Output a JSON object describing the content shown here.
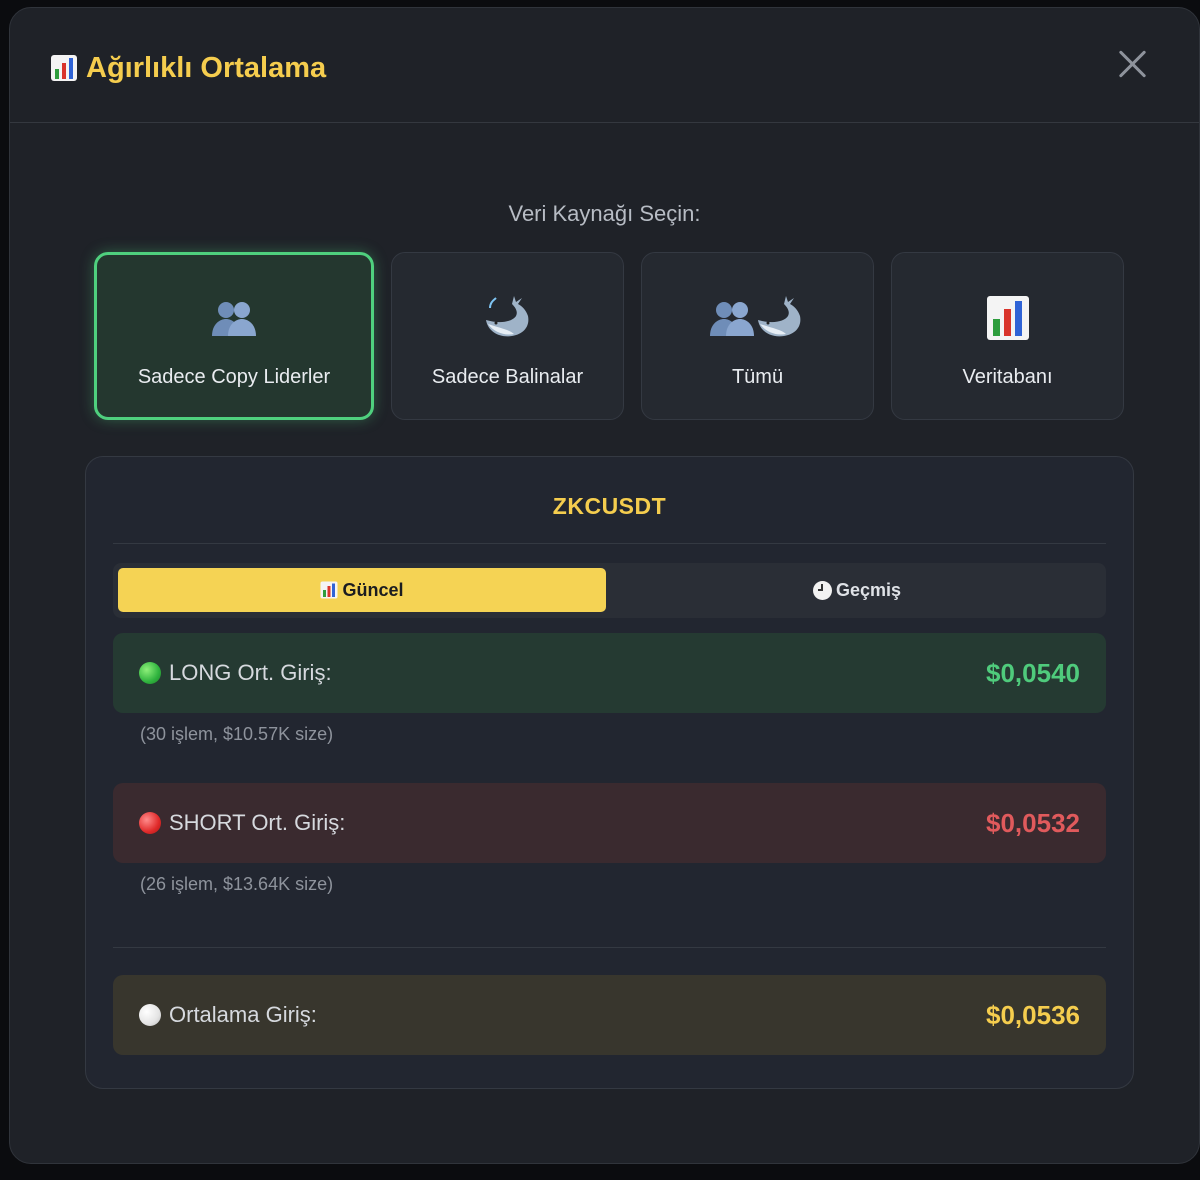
{
  "modal": {
    "title": "Ağırlıklı Ortalama",
    "title_icon": "bar-chart-icon",
    "close_icon": "close-icon"
  },
  "source_picker": {
    "label": "Veri Kaynağı Seçin:",
    "options": [
      {
        "label": "Sadece Copy Liderler",
        "icon": "people-icon",
        "selected": true
      },
      {
        "label": "Sadece Balinalar",
        "icon": "whale-icon",
        "selected": false
      },
      {
        "label": "Tümü",
        "icon": "people-whale-icon",
        "selected": false
      },
      {
        "label": "Veritabanı",
        "icon": "bar-chart-icon",
        "selected": false
      }
    ]
  },
  "panel": {
    "symbol": "ZKCUSDT",
    "tabs": [
      {
        "label": "Güncel",
        "icon": "bar-chart-icon",
        "active": true
      },
      {
        "label": "Geçmiş",
        "icon": "clock-icon",
        "active": false
      }
    ],
    "long": {
      "label": "LONG Ort. Giriş:",
      "value": "$0,0540",
      "detail": "(30 işlem, $10.57K size)"
    },
    "short": {
      "label": "SHORT Ort. Giriş:",
      "value": "$0,0532",
      "detail": "(26 işlem, $13.64K size)"
    },
    "average": {
      "label": "Ortalama Giriş:",
      "value": "$0,0536"
    }
  },
  "colors": {
    "accent": "#f5cd4e",
    "long": "#4fcb7c",
    "short": "#e05a5c",
    "selected_border": "#4fd07e"
  }
}
